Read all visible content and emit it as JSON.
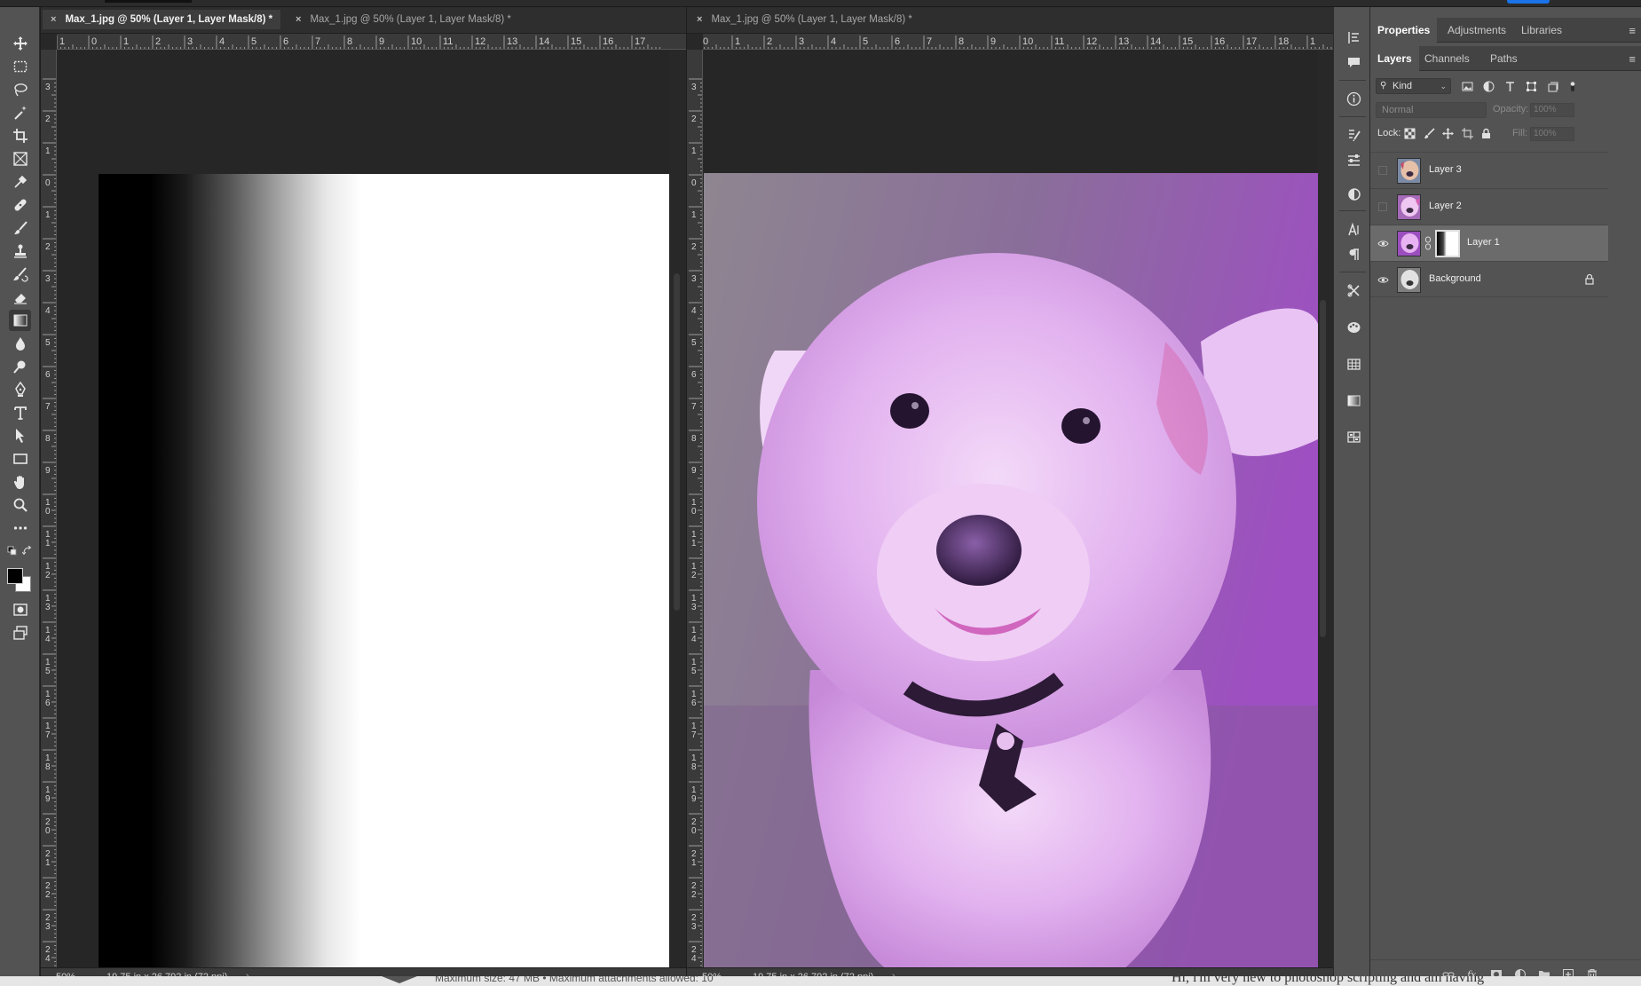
{
  "documents": [
    {
      "tabs": [
        {
          "close": "×",
          "title": "Max_1.jpg @ 50% (Layer 1, Layer Mask/8) *",
          "active": true
        },
        {
          "close": "×",
          "title": "Max_1.jpg @ 50% (Layer 1, Layer Mask/8) *",
          "active": false
        }
      ],
      "zoom": "50%",
      "doc_size": "19.75 in x 26.792 in (72 ppi)",
      "chevron": "›",
      "hruler_labels": [
        "1",
        "0",
        "1",
        "2",
        "3",
        "4",
        "5",
        "6",
        "7",
        "8",
        "9",
        "10",
        "11",
        "12",
        "13",
        "14",
        "15",
        "16",
        "17"
      ],
      "vruler_labels": [
        "3",
        "2",
        "1",
        "0",
        "1",
        "2",
        "3",
        "4",
        "5",
        "6",
        "7",
        "8",
        "9",
        "1\n0",
        "1\n1",
        "1\n2",
        "1\n3",
        "1\n4",
        "1\n5",
        "1\n6",
        "1\n7",
        "1\n8",
        "1\n9",
        "2\n0",
        "2\n1",
        "2\n2",
        "2\n3",
        "2\n4"
      ]
    },
    {
      "tabs": [
        {
          "close": "×",
          "title": "Max_1.jpg @ 50% (Layer 1, Layer Mask/8) *",
          "active": false
        }
      ],
      "zoom": "50%",
      "doc_size": "19.75 in x 26.792 in (72 ppi)",
      "chevron": "›",
      "hruler_labels": [
        "0",
        "1",
        "2",
        "3",
        "4",
        "5",
        "6",
        "7",
        "8",
        "9",
        "10",
        "11",
        "12",
        "13",
        "14",
        "15",
        "16",
        "17",
        "18",
        "1"
      ],
      "vruler_labels": [
        "3",
        "2",
        "1",
        "0",
        "1",
        "2",
        "3",
        "4",
        "5",
        "6",
        "7",
        "8",
        "9",
        "1\n0",
        "1\n1",
        "1\n2",
        "1\n3",
        "1\n4",
        "1\n5",
        "1\n6",
        "1\n7",
        "1\n8",
        "1\n9",
        "2\n0",
        "2\n1",
        "2\n2",
        "2\n3",
        "2\n4"
      ]
    }
  ],
  "collapse": {
    "left": "»",
    "mid": "«",
    "right": "»"
  },
  "panel_tabs_top": [
    "Properties",
    "Adjustments",
    "Libraries"
  ],
  "panel_tabs_layers": [
    "Layers",
    "Channels",
    "Paths"
  ],
  "panel_menu": "≡",
  "filter": {
    "label": "Kind",
    "search": "⚲",
    "dropdown": "⌄"
  },
  "blend": {
    "mode": "Normal",
    "opacity_label": "Opacity:",
    "opacity_value": "100%",
    "fill_label": "Fill:",
    "fill_value": "100%"
  },
  "lock": {
    "label": "Lock:"
  },
  "layers": [
    {
      "name": "Layer 3",
      "visible": false,
      "selected": false
    },
    {
      "name": "Layer 2",
      "visible": false,
      "selected": false
    },
    {
      "name": "Layer 1",
      "visible": true,
      "selected": true,
      "mask": true
    },
    {
      "name": "Background",
      "visible": true,
      "selected": false,
      "locked": true
    }
  ],
  "panel_bottom_icons": [
    "link-icon",
    "fx-icon",
    "mask-icon",
    "adjustment-icon",
    "folder-icon",
    "new-layer-icon",
    "trash-icon"
  ],
  "bottom_text": {
    "left": "Maximum size: 47 MB • Maximum attachments allowed: 10",
    "right": "Hi, i'm very new to photoshop scripting and am having"
  },
  "colors": {
    "foreground": "#000000",
    "background": "#ffffff",
    "accent": "#1a73e8"
  }
}
